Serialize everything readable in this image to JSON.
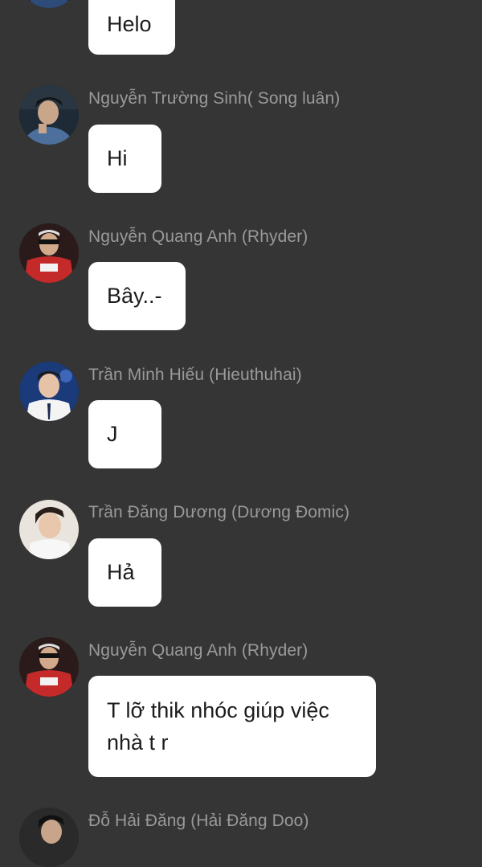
{
  "messages": [
    {
      "sender": "",
      "text": "Helo"
    },
    {
      "sender": "Nguyễn Trường Sinh( Song luân)",
      "text": "Hi"
    },
    {
      "sender": "Nguyễn Quang Anh (Rhyder)",
      "text": "Bây..-"
    },
    {
      "sender": "Trần Minh Hiếu (Hieuthuhai)",
      "text": "J"
    },
    {
      "sender": "Trần Đăng Dương (Dương Đomic)",
      "text": "Hả"
    },
    {
      "sender": "Nguyễn Quang Anh (Rhyder)",
      "text": "T lỡ thik nhóc giúp việc nhà t r"
    },
    {
      "sender": "Đỗ Hải Đăng (Hải Đăng Doo)",
      "text": ""
    }
  ],
  "colors": {
    "background": "#353535",
    "bubble": "#ffffff",
    "sender_text": "#9a9a9a",
    "message_text": "#1c1c1c"
  }
}
